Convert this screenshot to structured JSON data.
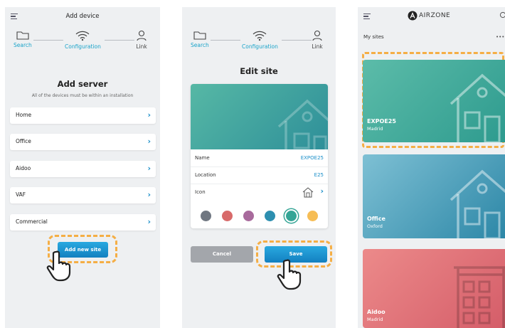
{
  "screen1": {
    "title": "Add device",
    "steps": [
      "Search",
      "Configuration",
      "Link"
    ],
    "heading": "Add server",
    "subheading": "All of the devices must be within an installation",
    "items": [
      {
        "label": "Home"
      },
      {
        "label": "Office"
      },
      {
        "label": "Aidoo"
      },
      {
        "label": "VAF"
      },
      {
        "label": "Commercial"
      }
    ],
    "add_button": "Add new site"
  },
  "screen2": {
    "steps": [
      "Search",
      "Configuration",
      "Link"
    ],
    "heading": "Edit site",
    "fields": [
      {
        "key": "Name",
        "value": "EXPOE25"
      },
      {
        "key": "Location",
        "value": "E25"
      },
      {
        "key": "Icon",
        "value": ""
      }
    ],
    "colors": [
      "#707781",
      "#d86a6a",
      "#a86a9c",
      "#2d8fb0",
      "#35a596",
      "#f6bd55"
    ],
    "selected_color_index": 4,
    "cancel": "Cancel",
    "save": "Save"
  },
  "screen3": {
    "brand": "AIRZONE",
    "section": "My sites",
    "more": "•••",
    "sites": [
      {
        "name": "EXPOE25",
        "location": "Madrid",
        "color_from": "#5cbca9",
        "color_to": "#2d9a8e"
      },
      {
        "name": "Office",
        "location": "Oxford",
        "color_from": "#7ec0d4",
        "color_to": "#2b86a6"
      },
      {
        "name": "Aidoo",
        "location": "Madrid",
        "color_from": "#ec8a8a",
        "color_to": "#d45c68"
      }
    ]
  },
  "colors": {
    "accent": "#1aa3c9",
    "highlight": "#f5ae45",
    "background": "#eef0f2"
  }
}
